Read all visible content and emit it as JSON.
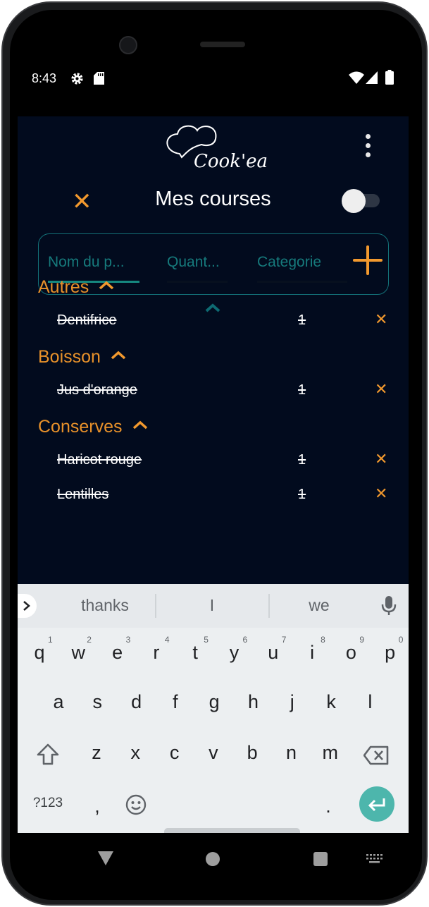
{
  "status_bar": {
    "time": "8:43",
    "icons": [
      "gear-icon",
      "sd-card-icon",
      "wifi-icon",
      "signal-icon",
      "battery-icon"
    ]
  },
  "app": {
    "logo_text": "Cook'eat",
    "title": "Mes courses",
    "toggle_on": false,
    "form": {
      "name_placeholder": "Nom du p...",
      "quantity_placeholder": "Quant...",
      "category_placeholder": "Categorie"
    },
    "categories": [
      {
        "name": "Autres",
        "items": [
          {
            "name": "Dentifrice",
            "qty": "1",
            "checked": true
          }
        ]
      },
      {
        "name": "Boisson",
        "items": [
          {
            "name": "Jus d'orange",
            "qty": "1",
            "checked": true
          }
        ]
      },
      {
        "name": "Conserves",
        "items": [
          {
            "name": "Haricot rouge",
            "qty": "1",
            "checked": true
          },
          {
            "name": "Lentilles",
            "qty": "1",
            "checked": true
          }
        ]
      }
    ],
    "colors": {
      "background": "#020b1e",
      "accent": "#f2992e",
      "teal": "#137178"
    }
  },
  "keyboard": {
    "suggestions": [
      "thanks",
      "I",
      "we"
    ],
    "row1": [
      "q",
      "w",
      "e",
      "r",
      "t",
      "y",
      "u",
      "i",
      "o",
      "p"
    ],
    "row1_hints": [
      "1",
      "2",
      "3",
      "4",
      "5",
      "6",
      "7",
      "8",
      "9",
      "0"
    ],
    "row2": [
      "a",
      "s",
      "d",
      "f",
      "g",
      "h",
      "j",
      "k",
      "l"
    ],
    "row3": [
      "z",
      "x",
      "c",
      "v",
      "b",
      "n",
      "m"
    ],
    "symbols_label": "?123",
    "comma": ",",
    "period": ".",
    "enter_color": "#4db6ac"
  }
}
